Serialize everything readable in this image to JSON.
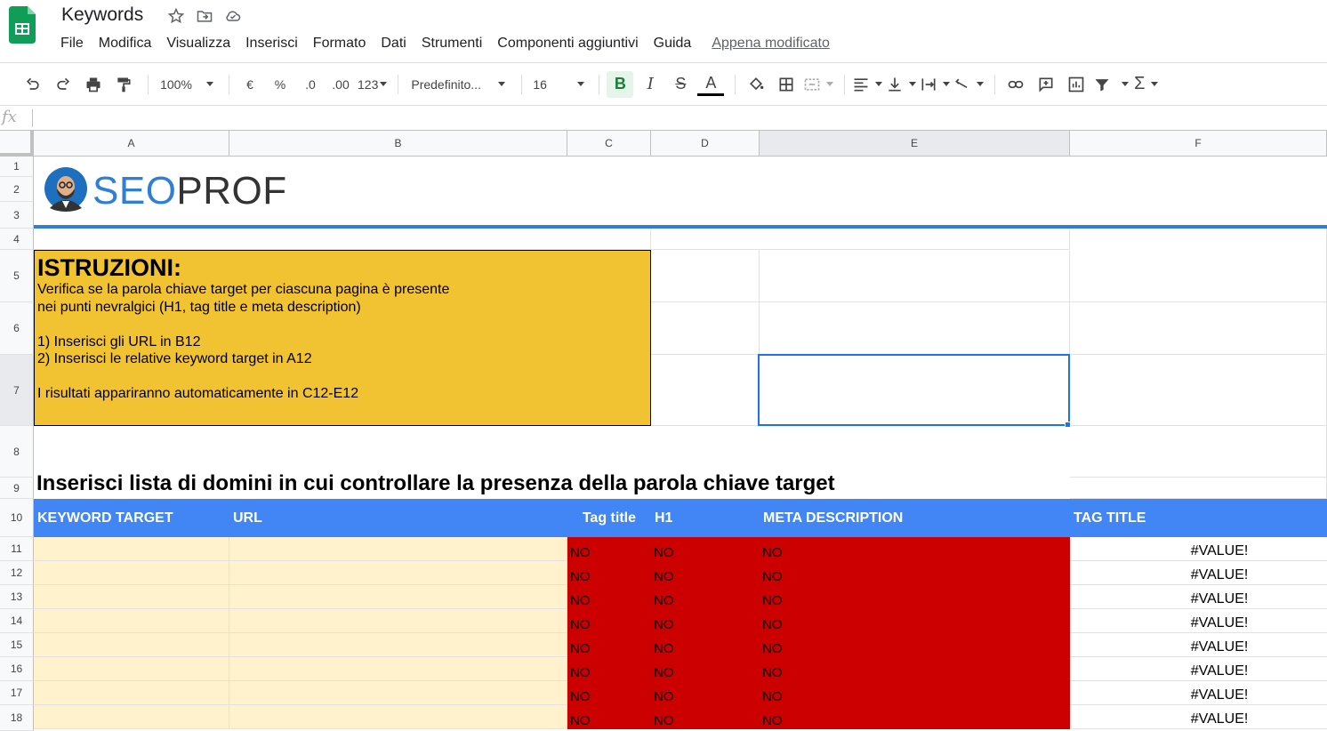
{
  "doc": {
    "title": "Keywords",
    "last_edit": "Appena modificato"
  },
  "menu": [
    "File",
    "Modifica",
    "Visualizza",
    "Inserisci",
    "Formato",
    "Dati",
    "Strumenti",
    "Componenti aggiuntivi",
    "Guida"
  ],
  "toolbar": {
    "zoom": "100%",
    "currency": "€",
    "percent": "%",
    "dec_less": ".0",
    "dec_more": ".00",
    "format_more": "123",
    "font": "Predefinito...",
    "font_size": "16",
    "bold": "B",
    "italic": "I",
    "strike": "S",
    "text_color": "A"
  },
  "formula_bar": {
    "fx": "fx",
    "value": ""
  },
  "columns": [
    "A",
    "B",
    "C",
    "D",
    "E",
    "F"
  ],
  "rows": [
    "1",
    "2",
    "3",
    "4",
    "5",
    "6",
    "7",
    "8",
    "9",
    "10",
    "11",
    "12",
    "13",
    "14",
    "15",
    "16",
    "17",
    "18"
  ],
  "logo": {
    "seo": "SEO",
    "prof": "PROF"
  },
  "instructions": {
    "heading": "ISTRUZIONI:",
    "line1": "Verifica se la parola chiave target per ciascuna pagina è presente",
    "line2": "nei punti nevralgici (H1, tag title e meta description)",
    "line3": "1) Inserisci gli URL in B12",
    "line4": "2) Inserisci le relative keyword target in A12",
    "line5": "I risultati appariranno automaticamente in C12-E12"
  },
  "subtitle": "Inserisci lista di domini in cui controllare la presenza della parola chiave target",
  "table": {
    "headers": [
      "KEYWORD TARGET",
      "URL",
      "Tag title",
      "H1",
      "META DESCRIPTION",
      "TAG TITLE"
    ],
    "no_value": "NO",
    "error_value": "#VALUE!",
    "colors": {
      "header": "#4285f4",
      "input": "#fff2cc",
      "result_no": "#cc0000"
    }
  }
}
